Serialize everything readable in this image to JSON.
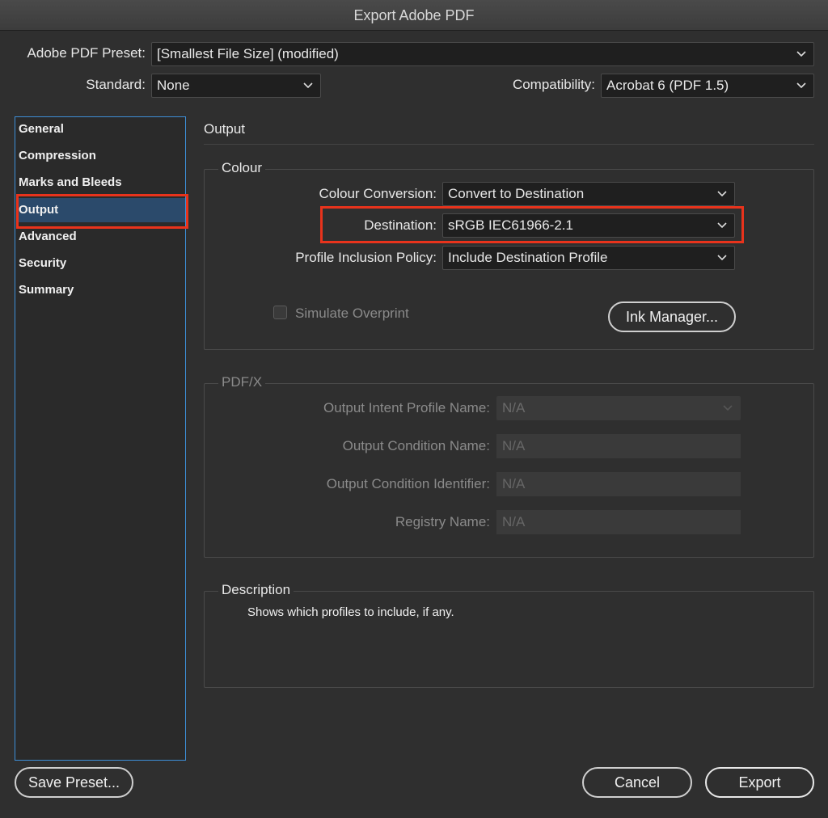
{
  "window": {
    "title": "Export Adobe PDF"
  },
  "header": {
    "preset_label": "Adobe PDF Preset:",
    "preset_value": "[Smallest File Size] (modified)",
    "standard_label": "Standard:",
    "standard_value": "None",
    "compat_label": "Compatibility:",
    "compat_value": "Acrobat 6 (PDF 1.5)"
  },
  "sidebar": {
    "items": [
      {
        "label": "General"
      },
      {
        "label": "Compression"
      },
      {
        "label": "Marks and Bleeds"
      },
      {
        "label": "Output"
      },
      {
        "label": "Advanced"
      },
      {
        "label": "Security"
      },
      {
        "label": "Summary"
      }
    ],
    "selected": "Output"
  },
  "main": {
    "title": "Output",
    "colour": {
      "title": "Colour",
      "conversion_label": "Colour Conversion:",
      "conversion_value": "Convert to Destination",
      "destination_label": "Destination:",
      "destination_value": "sRGB IEC61966-2.1",
      "policy_label": "Profile Inclusion Policy:",
      "policy_value": "Include Destination Profile",
      "simulate_label": "Simulate Overprint",
      "ink_manager_label": "Ink Manager..."
    },
    "pdfx": {
      "title": "PDF/X",
      "intent_label": "Output Intent Profile Name:",
      "intent_value": "N/A",
      "condition_name_label": "Output Condition Name:",
      "condition_name_value": "N/A",
      "condition_id_label": "Output Condition Identifier:",
      "condition_id_value": "N/A",
      "registry_label": "Registry Name:",
      "registry_value": "N/A"
    },
    "description": {
      "title": "Description",
      "text": "Shows which profiles to include, if any."
    }
  },
  "footer": {
    "save_preset_label": "Save Preset...",
    "cancel_label": "Cancel",
    "export_label": "Export"
  },
  "colors": {
    "highlight": "#e8331c",
    "sidebar_border": "#3d8fd8",
    "selected_bg": "#2b4a6b"
  }
}
